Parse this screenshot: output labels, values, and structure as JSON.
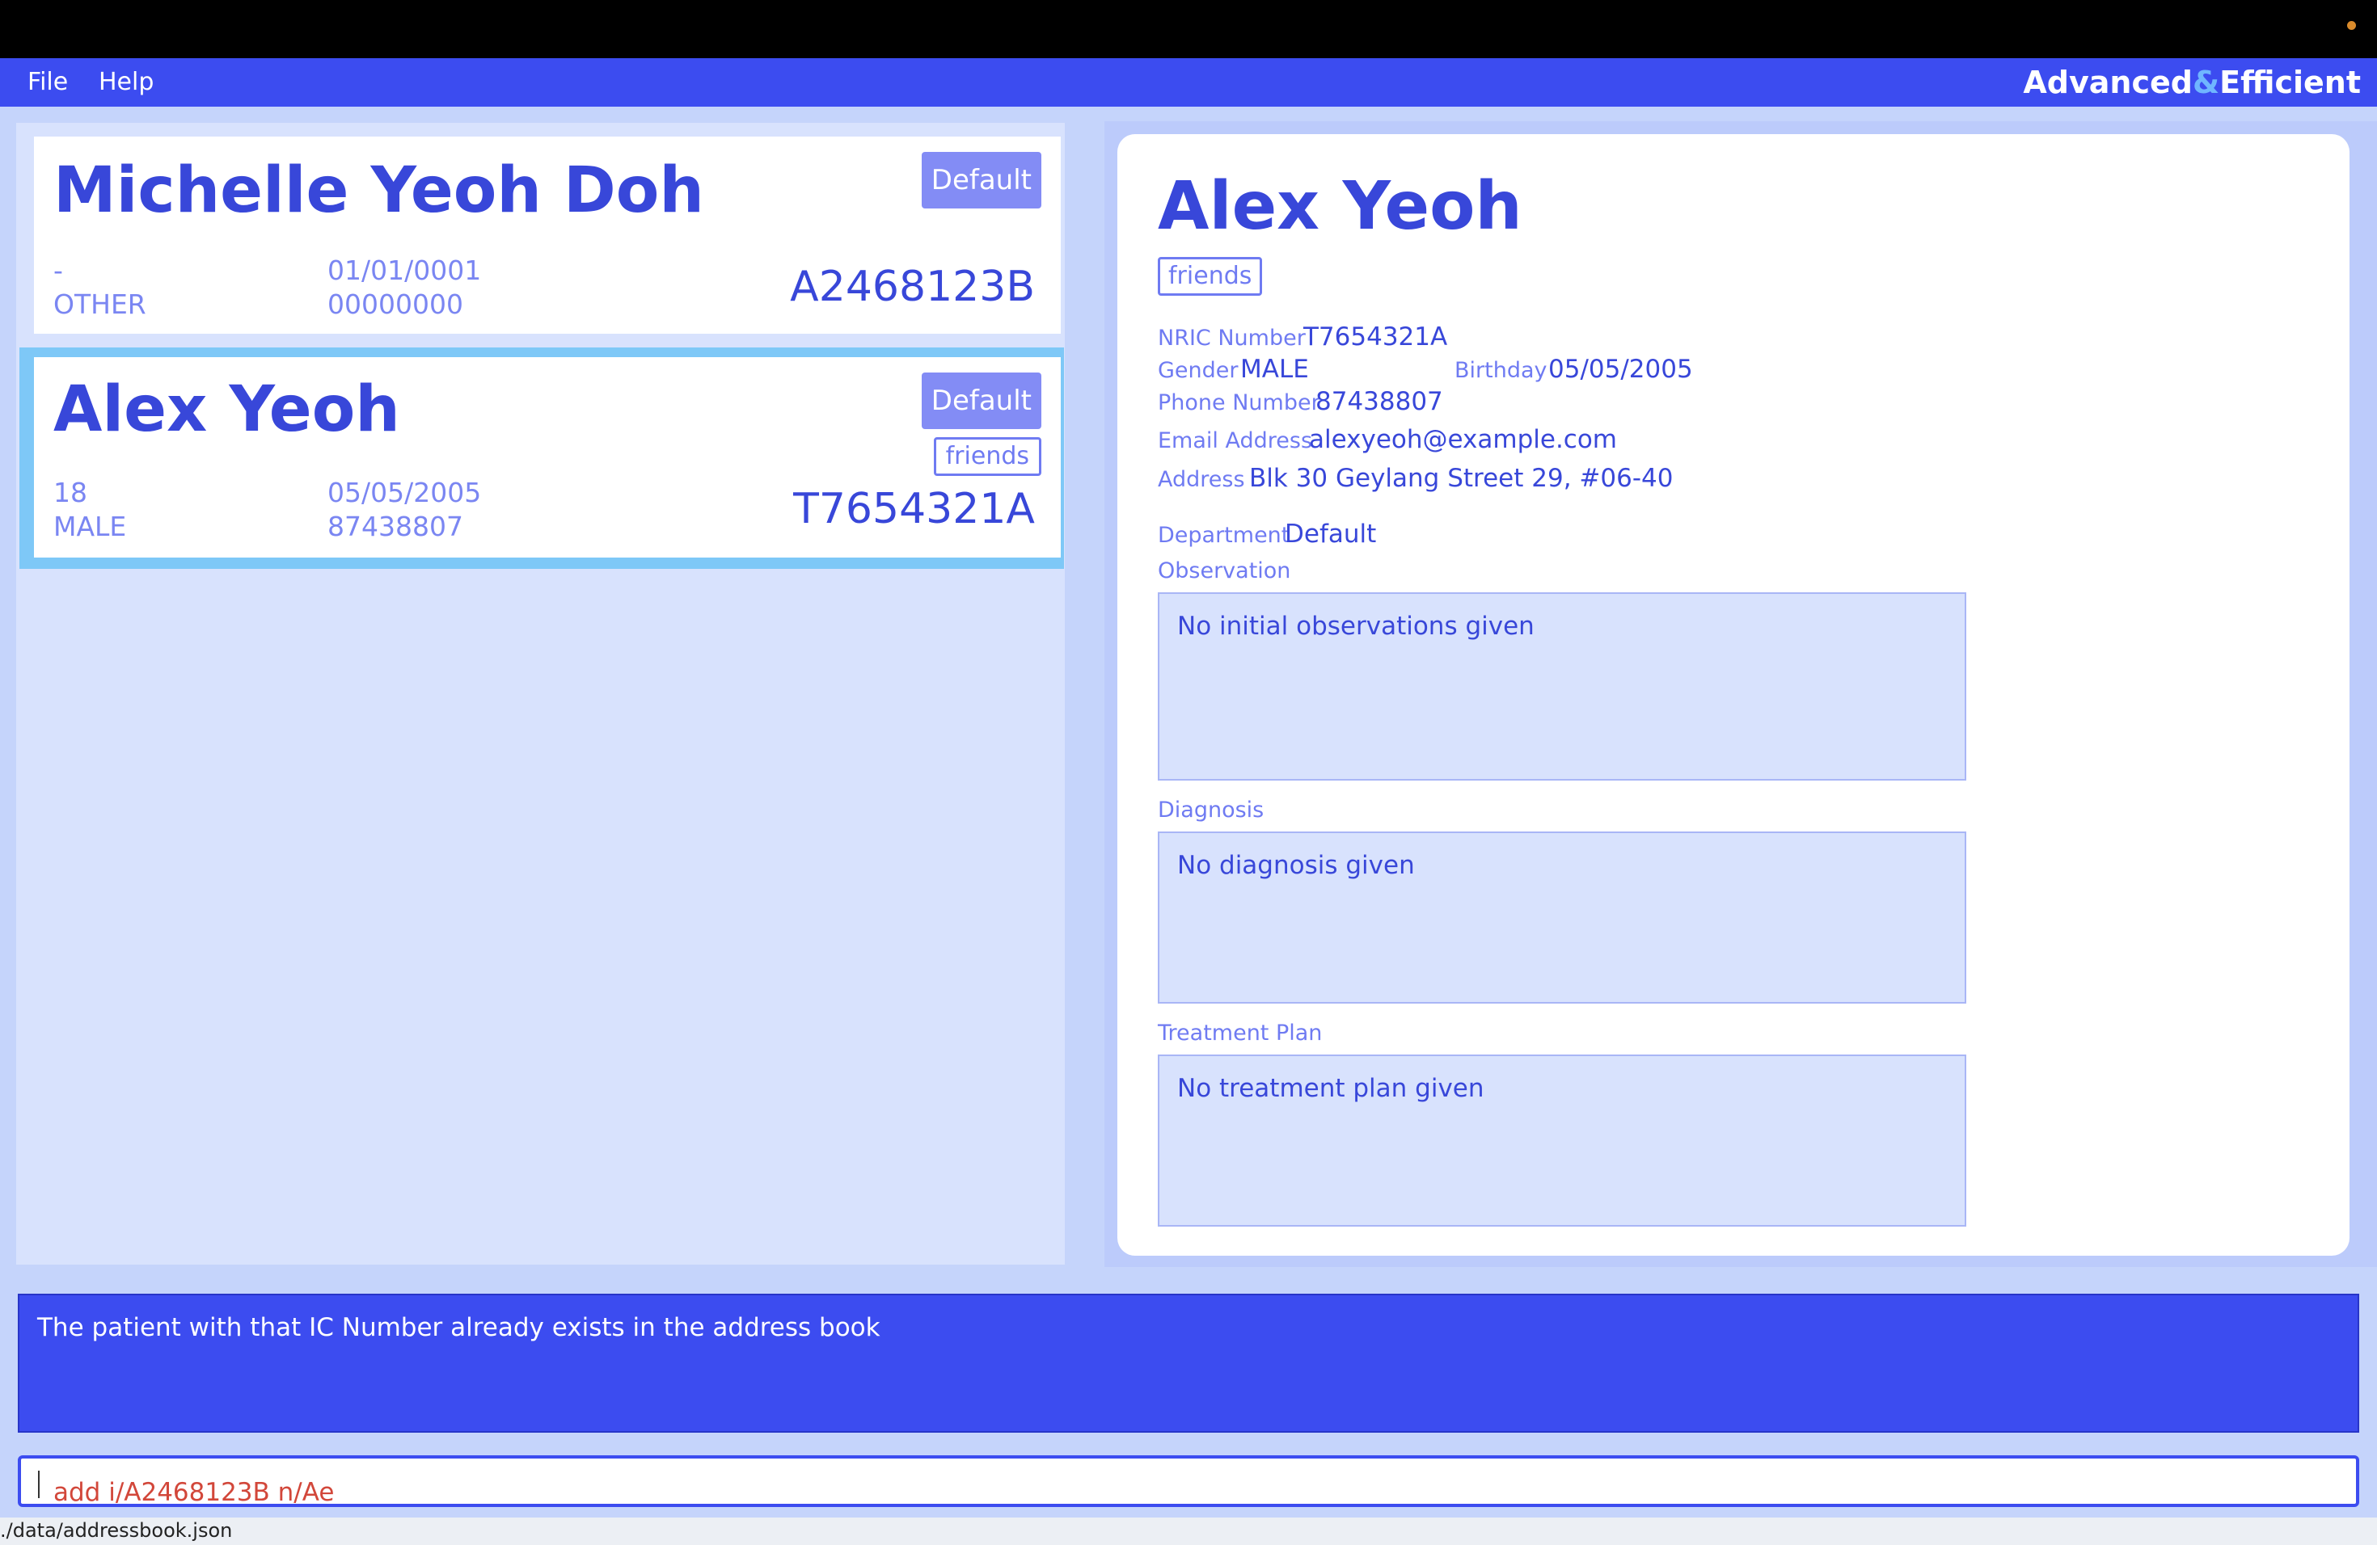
{
  "menubar": {
    "file": "File",
    "help": "Help",
    "brand_prefix": "Advanced",
    "brand_amp": "&",
    "brand_suffix": "Efficient"
  },
  "patients": [
    {
      "name": "Michelle Yeoh Doh",
      "department": "Default",
      "age": "-",
      "gender": "OTHER",
      "birthday": "01/01/0001",
      "phone": "00000000",
      "ic": "A2468123B",
      "tags": []
    },
    {
      "name": "Alex Yeoh",
      "department": "Default",
      "age": "18",
      "gender": "MALE",
      "birthday": "05/05/2005",
      "phone": "87438807",
      "ic": "T7654321A",
      "tags": [
        "friends"
      ],
      "selected": true
    }
  ],
  "detail": {
    "name": "Alex Yeoh",
    "tag": "friends",
    "nric_label": "NRIC Number",
    "nric": "T7654321A",
    "gender_label": "Gender",
    "gender": "MALE",
    "birthday_label": "Birthday",
    "birthday": "05/05/2005",
    "phone_label": "Phone Number",
    "phone": "87438807",
    "email_label": "Email Address",
    "email": "alexyeoh@example.com",
    "address_label": "Address",
    "address": "Blk 30 Geylang Street 29, #06-40",
    "department_label": "Department",
    "department": "Default",
    "observation_label": "Observation",
    "observation": "No initial observations given",
    "diagnosis_label": "Diagnosis",
    "diagnosis": "No diagnosis given",
    "treatment_label": "Treatment Plan",
    "treatment": "No treatment plan given"
  },
  "result": "The patient with that IC Number already exists in the address book",
  "command": "add i/A2468123B n/Ae",
  "status": "./data/addressbook.json",
  "colors": {
    "primary": "#3c4cf0",
    "selected_border": "#7ec8f7",
    "panel": "#d8e2fd",
    "error_text": "#d2473a"
  }
}
